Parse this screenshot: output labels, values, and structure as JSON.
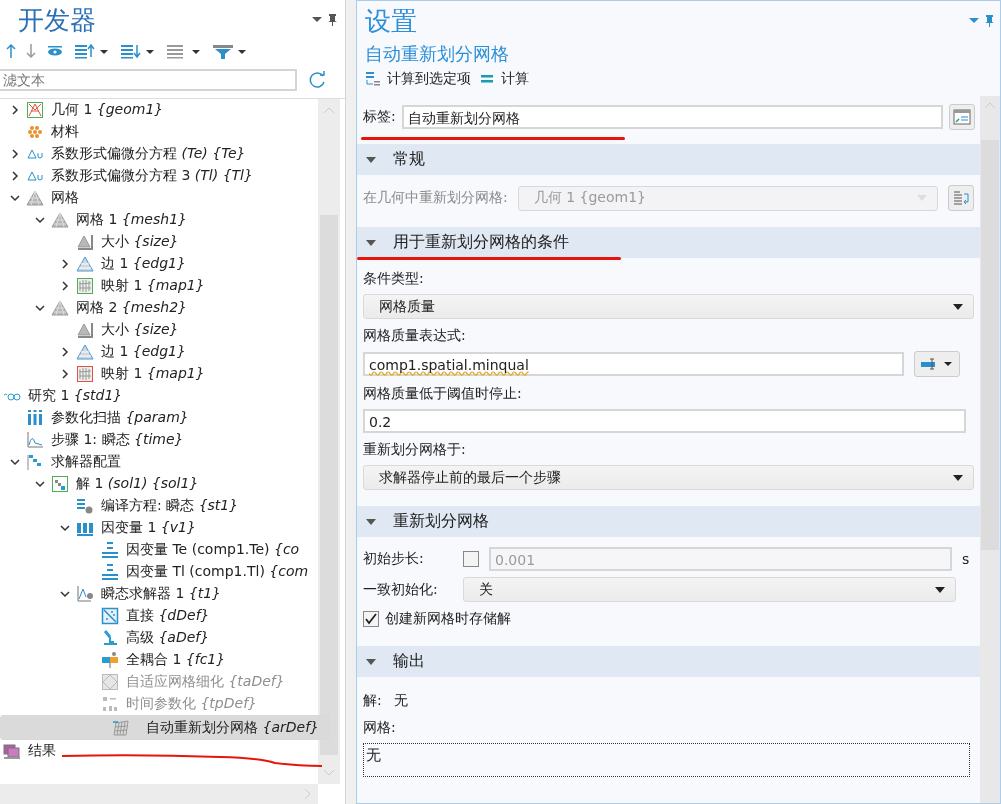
{
  "model_tree": {
    "title": "开发器",
    "filter": {
      "placeholder": "滤文本"
    },
    "tree": {
      "partial_children": [
        {
          "text": "几何 1 *{geom1}*",
          "kind": "geometry",
          "expanded": false,
          "selected": false,
          "disabled": false
        },
        {
          "text": "材料",
          "kind": "material",
          "selected": false,
          "disabled": false
        },
        {
          "text": "系数形式偏微分方程 *(Te) {Te}*",
          "kind": "pde",
          "expanded": false,
          "selected": false,
          "disabled": false
        },
        {
          "text": "系数形式偏微分方程 3 *(Tl) {Tl}*",
          "kind": "pde",
          "expanded": false,
          "selected": false,
          "disabled": false
        },
        {
          "text": "网格",
          "kind": "mesh",
          "expanded": true,
          "selected": false,
          "disabled": false,
          "children": [
            {
              "text": "网格 1 *{mesh1}*",
              "kind": "mesh",
              "expanded": true,
              "selected": false,
              "disabled": false,
              "children": [
                {
                  "text": "大小 *{size}*",
                  "kind": "size",
                  "selected": false,
                  "disabled": false
                },
                {
                  "text": "边 1 *{edg1}*",
                  "kind": "edge",
                  "expanded": false,
                  "selected": false,
                  "disabled": false
                },
                {
                  "text": "映射 1 *{map1}*",
                  "kind": "map",
                  "expanded": false,
                  "selected": false,
                  "disabled": false
                }
              ]
            },
            {
              "text": "网格 2 *{mesh2}*",
              "kind": "mesh",
              "expanded": true,
              "selected": false,
              "disabled": false,
              "children": [
                {
                  "text": "大小 *{size}*",
                  "kind": "size",
                  "selected": false,
                  "disabled": false
                },
                {
                  "text": "边 1 *{edg1}*",
                  "kind": "edge",
                  "expanded": false,
                  "selected": false,
                  "disabled": false
                },
                {
                  "text": "映射 1 *{map1}*",
                  "kind": "map-alert",
                  "expanded": false,
                  "selected": false,
                  "disabled": false
                }
              ]
            }
          ]
        }
      ],
      "nodes": [
        {
          "text": "研究 1 *{std1}*",
          "kind": "study",
          "expanded": true,
          "selected": false,
          "disabled": false,
          "annotated": false,
          "children": [
            {
              "text": "参数化扫描 *{param}*",
              "kind": "sweep",
              "selected": false,
              "disabled": false
            },
            {
              "text": " 步骤 1: 瞬态 *{time}*",
              "kind": "step",
              "selected": false,
              "disabled": false
            },
            {
              "text": "求解器配置",
              "kind": "solver",
              "expanded": true,
              "selected": false,
              "disabled": false,
              "children": [
                {
                  "text": "解 1 *(sol1) {sol1}*",
                  "kind": "solution",
                  "expanded": true,
                  "selected": false,
                  "disabled": false,
                  "children": [
                    {
                      "text": "编译方程: 瞬态 *{st1}*",
                      "kind": "compile",
                      "selected": false,
                      "disabled": false
                    },
                    {
                      "text": "因变量 1 *{v1}*",
                      "kind": "variables",
                      "expanded": true,
                      "selected": false,
                      "disabled": false,
                      "children": [
                        {
                          "text": "因变量 Te (comp1.Te) *{co*",
                          "kind": "field",
                          "selected": false,
                          "disabled": false
                        },
                        {
                          "text": "因变量 Tl (comp1.Tl) *{com*",
                          "kind": "field",
                          "selected": false,
                          "disabled": false
                        }
                      ]
                    },
                    {
                      "text": "瞬态求解器 1 *{t1}*",
                      "kind": "time-solver",
                      "expanded": true,
                      "selected": false,
                      "disabled": false,
                      "children": [
                        {
                          "text": "直接 *{dDef}*",
                          "kind": "direct",
                          "selected": false,
                          "disabled": false
                        },
                        {
                          "text": "高级 *{aDef}*",
                          "kind": "advanced",
                          "selected": false,
                          "disabled": false
                        },
                        {
                          "text": "全耦合 1 *{fc1}*",
                          "kind": "coupled",
                          "selected": false,
                          "disabled": false
                        },
                        {
                          "text": "自适应网格细化 *{taDef}*",
                          "kind": "adaptive",
                          "selected": false,
                          "disabled": true
                        },
                        {
                          "text": "时间参数化 *{tpDef}*",
                          "kind": "parametric",
                          "selected": false,
                          "disabled": true
                        },
                        {
                          "text": "自动重新划分网格 *{arDef}*",
                          "kind": "remesh",
                          "selected": true,
                          "disabled": false
                        }
                      ]
                    }
                  ]
                }
              ]
            }
          ]
        },
        {
          "text": "结果",
          "kind": "results",
          "selected": false,
          "disabled": false,
          "annotated": true
        }
      ]
    }
  },
  "settings": {
    "title": "设置",
    "subtitle": "自动重新划分网格",
    "toolbar": [
      {
        "label": "计算到选定项",
        "kind": "compute-to"
      },
      {
        "label": "计算",
        "kind": "compute"
      }
    ],
    "label_field": {
      "label": "标签:",
      "value": "自动重新划分网格",
      "annotated": true
    },
    "sections": [
      {
        "title": "常规",
        "expanded": true,
        "annotated": false,
        "rows": [
          {
            "kind": "inline-select",
            "label": "在几何中重新划分网格:",
            "value": "几何 1 {geom1}",
            "disabled": true
          }
        ]
      },
      {
        "title": "用于重新划分网格的条件",
        "expanded": true,
        "annotated": true,
        "rows": [
          {
            "kind": "label",
            "label": "条件类型:"
          },
          {
            "kind": "select",
            "value": "网格质量"
          },
          {
            "kind": "label",
            "label": "网格质量表达式:"
          },
          {
            "kind": "expression",
            "value": "comp1.spatial.minqual"
          },
          {
            "kind": "label",
            "label": "网格质量低于阈值时停止:"
          },
          {
            "kind": "input",
            "value": "0.2"
          },
          {
            "kind": "label",
            "label": "重新划分网格于:"
          },
          {
            "kind": "select",
            "value": "求解器停止前的最后一个步骤"
          }
        ]
      },
      {
        "title": "重新划分网格",
        "expanded": true,
        "annotated": false,
        "rows": [
          {
            "kind": "step",
            "label": "初始步长:",
            "checked": false,
            "value": "0.001",
            "unit": "s"
          },
          {
            "kind": "inline-select",
            "label": "一致初始化:",
            "value": "关",
            "disabled": false
          },
          {
            "kind": "checkbox",
            "label": "创建新网格时存储解",
            "checked": true
          }
        ]
      },
      {
        "title": "输出",
        "expanded": true,
        "annotated": false,
        "rows": [
          {
            "kind": "info",
            "label": "解:",
            "value": "无"
          },
          {
            "kind": "label",
            "label": "网格:"
          },
          {
            "kind": "listbox",
            "value": "无"
          }
        ]
      }
    ]
  }
}
